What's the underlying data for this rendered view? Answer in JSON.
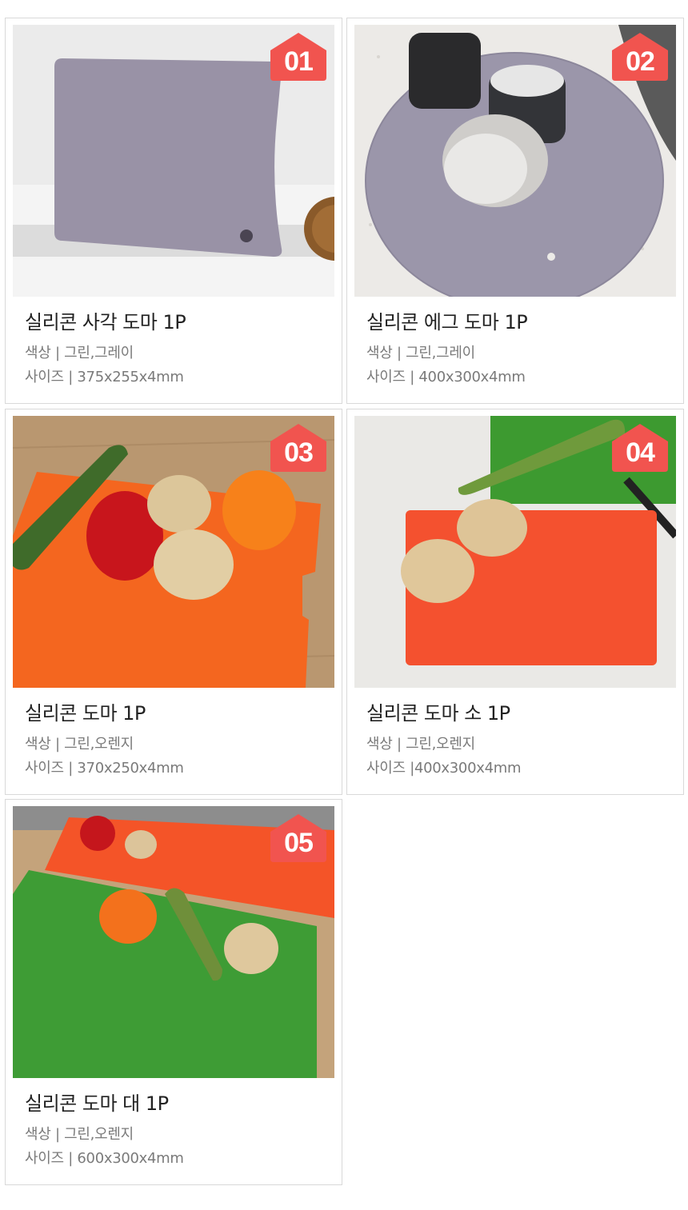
{
  "products": [
    {
      "number": "01",
      "title": "실리콘 사각 도마 1P",
      "color_line": "색상 | 그린,그레이",
      "size_line": "사이즈 | 375x255x4mm",
      "photo_icon": "gray-rectangular-board-image"
    },
    {
      "number": "02",
      "title": "실리콘 에그 도마 1P",
      "color_line": "색상 | 그린,그레이",
      "size_line": "사이즈 | 400x300x4mm",
      "photo_icon": "gray-egg-board-with-cups-image"
    },
    {
      "number": "03",
      "title": "실리콘 도마 1P",
      "color_line": "색상 | 그린,오렌지",
      "size_line": "사이즈 | 370x250x4mm",
      "photo_icon": "orange-board-with-vegetables-image"
    },
    {
      "number": "04",
      "title": "실리콘 도마 소 1P",
      "color_line": "색상 | 그린,오렌지",
      "size_line": "사이즈 |400x300x4mm",
      "photo_icon": "small-orange-board-with-potatoes-image"
    },
    {
      "number": "05",
      "title": "실리콘 도마 대 1P",
      "color_line": "색상 | 그린,오렌지",
      "size_line": "사이즈 | 600x300x4mm",
      "photo_icon": "large-green-orange-boards-image"
    }
  ],
  "colors": {
    "badge": "#f1544f",
    "gray_board": "#9992a6",
    "orange_board": "#f4572b",
    "green_board": "#3f9a33",
    "card_border": "#d9d9d9"
  }
}
